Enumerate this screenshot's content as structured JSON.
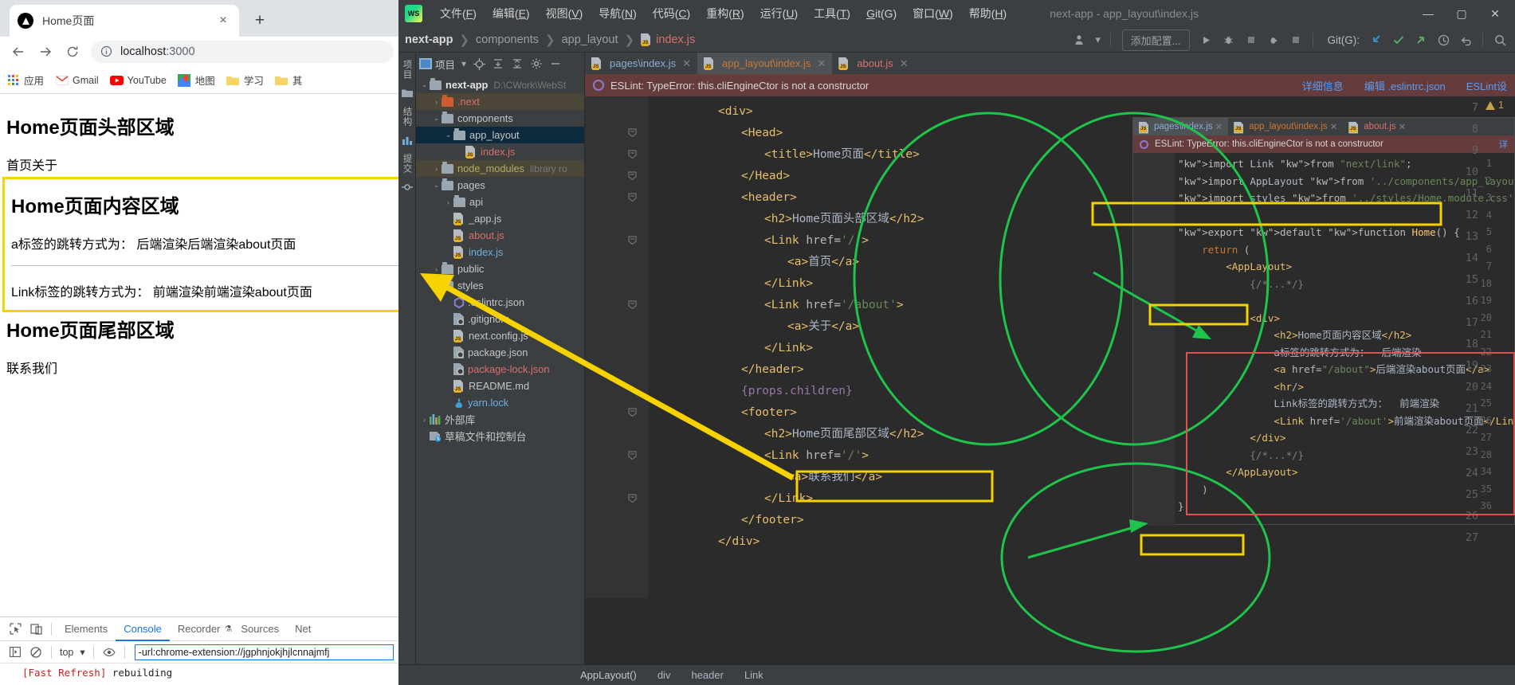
{
  "browser": {
    "tab": {
      "title": "Home页面",
      "close_label": "×",
      "favicon": "nextjs-logo-icon"
    },
    "newtab_label": "+",
    "nav": {
      "back": "←",
      "forward": "→",
      "reload": "⟳",
      "info_icon": "info-icon"
    },
    "omnibox": {
      "host": "localhost",
      "port": ":3000"
    },
    "bookmarks": [
      {
        "label": "应用",
        "icon": "apps-grid-icon"
      },
      {
        "label": "Gmail",
        "icon": "gmail-icon"
      },
      {
        "label": "YouTube",
        "icon": "youtube-icon"
      },
      {
        "label": "地图",
        "icon": "maps-icon"
      },
      {
        "label": "学习",
        "icon": "folder-icon"
      },
      {
        "label": "其",
        "icon": "folder-icon"
      }
    ],
    "page": {
      "header_heading": "Home页面头部区域",
      "header_links": "首页关于",
      "content_heading": "Home页面内容区域",
      "content_line1": "a标签的跳转方式为： 后端渲染后端渲染about页面",
      "content_line2": "Link标签的跳转方式为： 前端渲染前端渲染about页面",
      "footer_heading": "Home页面尾部区域",
      "footer_link": "联系我们"
    },
    "devtools": {
      "tabs": [
        "Elements",
        "Console",
        "Recorder",
        "Sources",
        "Net"
      ],
      "active_tab": "Console",
      "recorder_badge": "⚗",
      "context": "top",
      "filter_value": "-url:chrome-extension://jgphnjokjhjlcnnajmfj",
      "console_lines": [
        {
          "tag": "[Fast Refresh]",
          "text": " rebuilding"
        }
      ]
    }
  },
  "ide": {
    "logo": "WS",
    "menu": [
      {
        "label": "文件",
        "accel": "F"
      },
      {
        "label": "编辑",
        "accel": "E"
      },
      {
        "label": "视图",
        "accel": "V"
      },
      {
        "label": "导航",
        "accel": "N"
      },
      {
        "label": "代码",
        "accel": "C"
      },
      {
        "label": "重构",
        "accel": "R"
      },
      {
        "label": "运行",
        "accel": "U"
      },
      {
        "label": "工具",
        "accel": "T"
      },
      {
        "label": "Git",
        "accel": "G"
      },
      {
        "label": "窗口",
        "accel": "W"
      },
      {
        "label": "帮助",
        "accel": "H"
      }
    ],
    "window_title": "next-app - app_layout\\index.js",
    "window_buttons": [
      "—",
      "▢",
      "✕"
    ],
    "breadcrumb": [
      "next-app",
      "components",
      "app_layout",
      "index.js"
    ],
    "toolbar": {
      "add_config": "添加配置...",
      "git_label": "Git(G):",
      "run_icon": "run-icon",
      "debug_icon": "debug-icon",
      "stop_icon": "stop-icon",
      "coverage_icon": "coverage-icon",
      "profile_icon": "profile-icon",
      "update_icon": "git-update-icon",
      "commit_icon": "git-commit-icon",
      "push_icon": "git-push-icon",
      "history_icon": "git-history-icon",
      "rollback_icon": "git-rollback-icon",
      "search_icon": "search-icon",
      "user_icon": "user-icon"
    },
    "rails": [
      {
        "label": "项目",
        "name": "tool-window-project"
      },
      {
        "label": "",
        "name": "tool-window-files-icon"
      },
      {
        "label": "结构",
        "name": "tool-window-structure"
      },
      {
        "label": "",
        "name": "tool-window-bookmarks-icon"
      },
      {
        "label": "提交",
        "name": "tool-window-commit"
      },
      {
        "label": "",
        "name": "tool-window-vcs-icon"
      }
    ],
    "project_panel": {
      "title": "项目",
      "toolbar_icons": [
        "locate-icon",
        "expand-all-icon",
        "collapse-all-icon",
        "settings-gear-icon",
        "hide-icon"
      ],
      "tree": [
        {
          "indent": 0,
          "arrow": "v",
          "icon": "folder",
          "name": "next-app",
          "style": "white bold",
          "sub": "D:\\CWork\\WebSt",
          "state": ""
        },
        {
          "indent": 1,
          "arrow": ">",
          "icon": "folder-orange",
          "name": ".next",
          "style": "red",
          "sub": "",
          "state": "hl"
        },
        {
          "indent": 1,
          "arrow": "v",
          "icon": "folder",
          "name": "components",
          "style": "",
          "sub": "",
          "state": ""
        },
        {
          "indent": 2,
          "arrow": "v",
          "icon": "folder",
          "name": "app_layout",
          "style": "",
          "sub": "",
          "state": "sel"
        },
        {
          "indent": 3,
          "arrow": "",
          "icon": "js",
          "name": "index.js",
          "style": "red",
          "sub": "",
          "state": ""
        },
        {
          "indent": 1,
          "arrow": ">",
          "icon": "folder",
          "name": "node_modules",
          "style": "olive",
          "sub": "library ro",
          "state": "hl"
        },
        {
          "indent": 1,
          "arrow": "v",
          "icon": "folder",
          "name": "pages",
          "style": "",
          "sub": "",
          "state": ""
        },
        {
          "indent": 2,
          "arrow": ">",
          "icon": "folder",
          "name": "api",
          "style": "",
          "sub": "",
          "state": ""
        },
        {
          "indent": 2,
          "arrow": "",
          "icon": "js",
          "name": "_app.js",
          "style": "",
          "sub": "",
          "state": ""
        },
        {
          "indent": 2,
          "arrow": "",
          "icon": "js",
          "name": "about.js",
          "style": "red",
          "sub": "",
          "state": ""
        },
        {
          "indent": 2,
          "arrow": "",
          "icon": "js",
          "name": "index.js",
          "style": "blue",
          "sub": "",
          "state": ""
        },
        {
          "indent": 1,
          "arrow": ">",
          "icon": "folder",
          "name": "public",
          "style": "",
          "sub": "",
          "state": ""
        },
        {
          "indent": 1,
          "arrow": ">",
          "icon": "folder",
          "name": "styles",
          "style": "",
          "sub": "",
          "state": ""
        },
        {
          "indent": 2,
          "arrow": "",
          "icon": "eslint",
          "name": ".eslintrc.json",
          "style": "",
          "sub": "",
          "state": ""
        },
        {
          "indent": 2,
          "arrow": "",
          "icon": "git",
          "name": ".gitignore",
          "style": "",
          "sub": "",
          "state": ""
        },
        {
          "indent": 2,
          "arrow": "",
          "icon": "js",
          "name": "next.config.js",
          "style": "",
          "sub": "",
          "state": ""
        },
        {
          "indent": 2,
          "arrow": "",
          "icon": "json",
          "name": "package.json",
          "style": "",
          "sub": "",
          "state": ""
        },
        {
          "indent": 2,
          "arrow": "",
          "icon": "json",
          "name": "package-lock.json",
          "style": "red",
          "sub": "",
          "state": ""
        },
        {
          "indent": 2,
          "arrow": "",
          "icon": "md",
          "name": "README.md",
          "style": "",
          "sub": "",
          "state": ""
        },
        {
          "indent": 2,
          "arrow": "",
          "icon": "yarn",
          "name": "yarn.lock",
          "style": "blue",
          "sub": "",
          "state": ""
        },
        {
          "indent": 0,
          "arrow": ">",
          "icon": "lib",
          "name": "外部库",
          "style": "",
          "sub": "",
          "state": ""
        },
        {
          "indent": 0,
          "arrow": "",
          "icon": "scratch",
          "name": "草稿文件和控制台",
          "style": "",
          "sub": "",
          "state": ""
        }
      ]
    },
    "editor_tabs": [
      {
        "label": "pages\\index.js",
        "color": "blue",
        "active": false
      },
      {
        "label": "app_layout\\index.js",
        "color": "orange",
        "active": true
      },
      {
        "label": "about.js",
        "color": "red",
        "active": false
      }
    ],
    "eslint_error": {
      "message": "ESLint: TypeError: this.cliEngineCtor is not a constructor",
      "links": [
        "详细信息",
        "编辑 .eslintrc.json",
        "ESLint设"
      ]
    },
    "warning_chip": "1",
    "code_lines": [
      {
        "n": 7,
        "indent": 6,
        "text": "<div>"
      },
      {
        "n": 8,
        "indent": 8,
        "text": "<Head>"
      },
      {
        "n": 9,
        "indent": 10,
        "text": "<title>Home页面</title>"
      },
      {
        "n": 10,
        "indent": 8,
        "text": "</Head>"
      },
      {
        "n": 11,
        "indent": 8,
        "text": "<header>"
      },
      {
        "n": 12,
        "indent": 10,
        "text": "<h2>Home页面头部区域</h2>"
      },
      {
        "n": 13,
        "indent": 10,
        "text": "<Link href='/'>"
      },
      {
        "n": 14,
        "indent": 12,
        "text": "<a>首页</a>"
      },
      {
        "n": 15,
        "indent": 10,
        "text": "</Link>"
      },
      {
        "n": 16,
        "indent": 10,
        "text": "<Link href='/about'>"
      },
      {
        "n": 17,
        "indent": 12,
        "text": "<a>关于</a>"
      },
      {
        "n": 18,
        "indent": 10,
        "text": "</Link>"
      },
      {
        "n": 19,
        "indent": 8,
        "text": "</header>"
      },
      {
        "n": 20,
        "indent": 8,
        "text": "{props.children}"
      },
      {
        "n": 21,
        "indent": 8,
        "text": "<footer>"
      },
      {
        "n": 22,
        "indent": 10,
        "text": "<h2>Home页面尾部区域</h2>"
      },
      {
        "n": 23,
        "indent": 10,
        "text": "<Link href='/'>"
      },
      {
        "n": 24,
        "indent": 12,
        "text": "<a>联系我们</a>"
      },
      {
        "n": 25,
        "indent": 10,
        "text": "</Link>"
      },
      {
        "n": 26,
        "indent": 8,
        "text": "</footer>"
      },
      {
        "n": 27,
        "indent": 6,
        "text": "</div>"
      }
    ],
    "preview": {
      "tabs": [
        {
          "label": "pages\\index.js",
          "color": "blue",
          "active": true
        },
        {
          "label": "app_layout\\index.js",
          "color": "orange",
          "active": false
        },
        {
          "label": "about.js",
          "color": "red",
          "active": false
        }
      ],
      "error": "ESLint: TypeError: this.cliEngineCtor is not a constructor",
      "error_link": "详",
      "lines": [
        {
          "n": 1,
          "text": "import Link from \"next/link\";"
        },
        {
          "n": 2,
          "text": "import AppLayout from '../components/app_layout'"
        },
        {
          "n": 3,
          "text": "import styles from '../styles/Home.module.css'"
        },
        {
          "n": 4,
          "text": ""
        },
        {
          "n": 5,
          "text": "export default function Home() {"
        },
        {
          "n": 6,
          "text": "    return ("
        },
        {
          "n": 7,
          "text": "        <AppLayout>"
        },
        {
          "n": 18,
          "text": "            {/*...*/}"
        },
        {
          "n": 19,
          "text": ""
        },
        {
          "n": 20,
          "text": "            <div>"
        },
        {
          "n": 21,
          "text": "                <h2>Home页面内容区域</h2>"
        },
        {
          "n": 22,
          "text": "                a标签的跳转方式为：  后端渲染"
        },
        {
          "n": 23,
          "text": "                <a href=\"/about\">后端渲染about页面</a>"
        },
        {
          "n": 24,
          "text": "                <hr/>"
        },
        {
          "n": 25,
          "text": "                Link标签的跳转方式为：  前端渲染"
        },
        {
          "n": 26,
          "text": "                <Link href='/about'>前端渲染about页面</Link>"
        },
        {
          "n": 27,
          "text": "            </div>"
        },
        {
          "n": 28,
          "text": "            {/*...*/}"
        },
        {
          "n": 34,
          "text": "        </AppLayout>"
        },
        {
          "n": 35,
          "text": "    )"
        },
        {
          "n": 36,
          "text": "}"
        }
      ]
    },
    "statusbar": [
      "AppLayout()",
      "div",
      "header",
      "Link"
    ]
  }
}
